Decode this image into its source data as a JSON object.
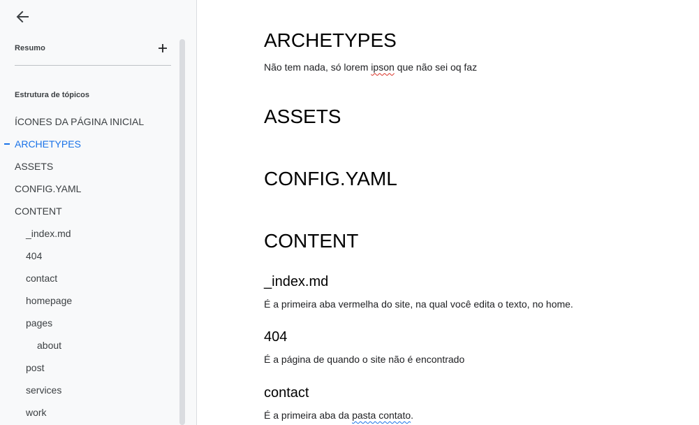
{
  "sidebar": {
    "summary_label": "Resumo",
    "outline_label": "Estrutura de tópicos",
    "items": [
      {
        "label": "ÍCONES DA PÁGINA INICIAL",
        "level": 1
      },
      {
        "label": "ARCHETYPES",
        "level": 1,
        "active": true
      },
      {
        "label": "ASSETS",
        "level": 1
      },
      {
        "label": "CONFIG.YAML",
        "level": 1
      },
      {
        "label": "CONTENT",
        "level": 1
      },
      {
        "label": "_index.md",
        "level": 2
      },
      {
        "label": "404",
        "level": 2
      },
      {
        "label": "contact",
        "level": 2
      },
      {
        "label": "homepage",
        "level": 2
      },
      {
        "label": "pages",
        "level": 2
      },
      {
        "label": "about",
        "level": 3
      },
      {
        "label": "post",
        "level": 2
      },
      {
        "label": "services",
        "level": 2
      },
      {
        "label": "work",
        "level": 2
      }
    ]
  },
  "document": {
    "archetypes": {
      "heading": "ARCHETYPES",
      "text_before": "Não tem nada, só lorem ",
      "text_misspelled": "ipson",
      "text_after": " que não sei oq faz"
    },
    "assets": {
      "heading": "ASSETS"
    },
    "config": {
      "heading": "CONFIG.YAML"
    },
    "content": {
      "heading": "CONTENT"
    },
    "index_md": {
      "heading": "_index.md",
      "text": "É a primeira aba vermelha do site, na qual você edita o texto, no home."
    },
    "p404": {
      "heading": "404",
      "text": "É a página de quando o site não é encontrado"
    },
    "contact": {
      "heading": "contact",
      "text_before": "É a primeira aba da ",
      "text_flagged": "pasta contato",
      "text_after": "."
    }
  },
  "colors": {
    "accent": "#1a73e8",
    "sidebar_bg": "#f8f9fa",
    "spell_error": "#d93025"
  }
}
